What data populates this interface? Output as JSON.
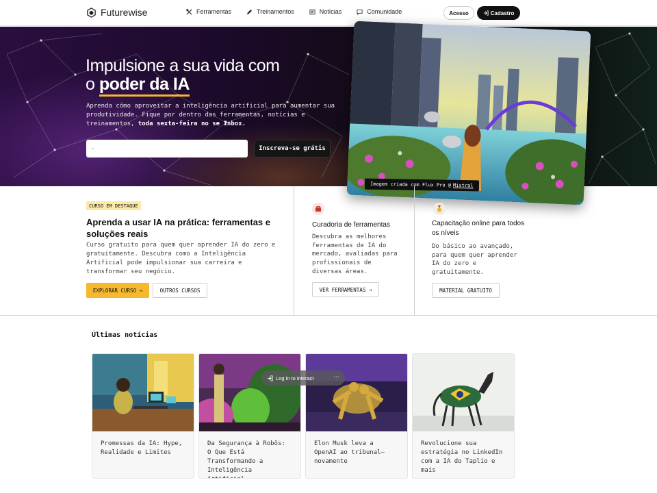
{
  "nav": {
    "brand": "Futurewise",
    "links": [
      {
        "label": "Ferramentas",
        "icon": "tools-icon"
      },
      {
        "label": "Treinamentos",
        "icon": "pen-icon"
      },
      {
        "label": "Notícias",
        "icon": "newspaper-icon"
      },
      {
        "label": "Comunidade",
        "icon": "chat-icon"
      }
    ],
    "login": "Acesso",
    "signup": "Cadastro"
  },
  "hero": {
    "title_line1": "Impulsione a sua vida com",
    "title_prefix": "o ",
    "title_highlight": "poder da IA",
    "subtitle": "Aprenda cómo aproveitar a inteligência artificial para aumentar sua produtividade. Fique por dentro das ferramentas, notícias e treinamentos,",
    "subtitle_bold": "toda sexta-feira no se Inbox.",
    "email_placeholder": "-",
    "subscribe": "Inscreva-se grátis",
    "image_caption": "Imagem criada com Flux Pro @",
    "image_caption_link": "Mistral"
  },
  "featured": {
    "badge": "CURSO EM DESTAQUE",
    "title": "Aprenda a usar IA na prática: ferramentas e soluções reais",
    "description": "Curso gratuito para quem quer aprender IA do zero e gratuitamente. Descubra como a Inteligência Artificial pode impulsionar sua carreira e transformar seu negócio.",
    "primary_button": "EXPLORAR CURSO →",
    "secondary_button": "OUTROS CURSOS"
  },
  "col_tools": {
    "title": "Curadoria de ferramentas",
    "description": "Descubra as melhores ferramentas de IA do mercado, avaliadas para profissionais de diversas áreas.",
    "button": "VER FERRAMENTAS →"
  },
  "col_training": {
    "title": "Capacitação online para todos os níveis",
    "description": "Do básico ao avançado, para quem quer aprender IA do zero e gratuitamente.",
    "button": "MATERIAL GRATUITO"
  },
  "news": {
    "heading": "Últimas notícias",
    "overlay": "Log in to interact",
    "overlay_more": "···",
    "cards": [
      {
        "title": "Promessas da IA: Hype, Realidade e Limites"
      },
      {
        "title": "Da Segurança à Robôs: O Que Está Transformando a Inteligência Artificial"
      },
      {
        "title": "Elon Musk leva a OpenAI ao tribunal—novamente"
      },
      {
        "title": "Revolucione sua estratégia no LinkedIn com a IA do Taplio e mais"
      }
    ]
  },
  "colors": {
    "accent_yellow": "#f5b82e",
    "badge_bg": "#fbe9a6",
    "dark": "#111111"
  }
}
